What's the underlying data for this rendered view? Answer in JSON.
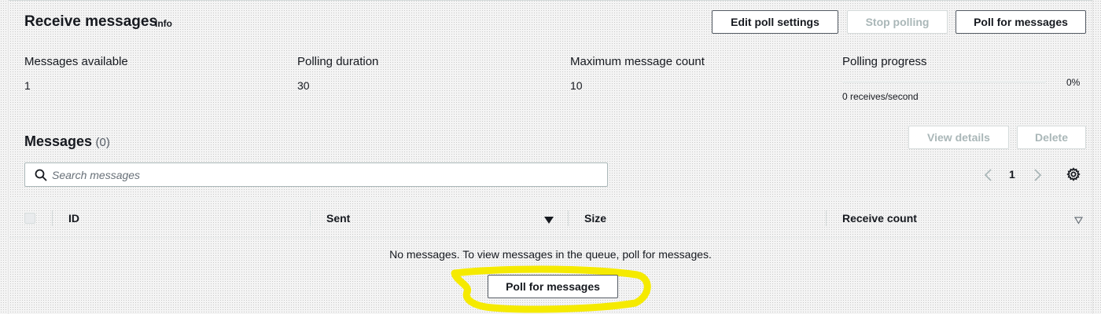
{
  "header": {
    "title": "Receive messages",
    "info": "Info",
    "buttons": {
      "edit_poll_settings": "Edit poll settings",
      "stop_polling": "Stop polling",
      "poll_for_messages": "Poll for messages"
    }
  },
  "summary": {
    "messages_available": {
      "label": "Messages available",
      "value": "1"
    },
    "polling_duration": {
      "label": "Polling duration",
      "value": "30"
    },
    "maximum_message_count": {
      "label": "Maximum message count",
      "value": "10"
    },
    "polling_progress": {
      "label": "Polling progress",
      "percent_text": "0%",
      "percent": 0,
      "rate": "0 receives/second"
    }
  },
  "messages": {
    "title": "Messages",
    "count": "(0)",
    "buttons": {
      "view_details": "View details",
      "delete": "Delete"
    },
    "search": {
      "placeholder": "Search messages",
      "value": ""
    },
    "pagination": {
      "current_page": "1"
    },
    "columns": {
      "id": "ID",
      "sent": "Sent",
      "size": "Size",
      "receive_count": "Receive count"
    },
    "empty_text": "No messages. To view messages in the queue, poll for messages.",
    "empty_button": "Poll for messages"
  },
  "colors": {
    "accent": "#0073bb",
    "text": "#16191f",
    "border": "#545b64",
    "disabled": "#aab7b8",
    "highlight": "#f5ea00"
  },
  "icons": [
    "search-icon",
    "chevron-left-icon",
    "chevron-right-icon",
    "gear-icon",
    "caret-down-icon",
    "caret-down-outline-icon"
  ]
}
